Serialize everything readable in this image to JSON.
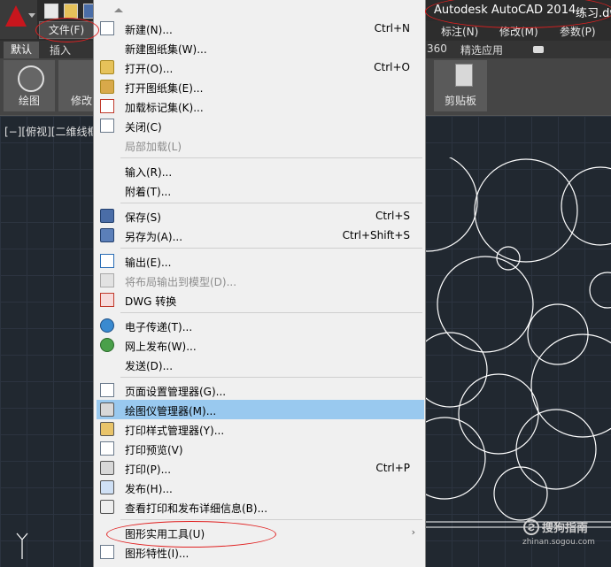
{
  "titlebar": {
    "title": "Autodesk AutoCAD 2014",
    "filename": "练习.dw"
  },
  "menubar": {
    "items": [
      "文件(F)",
      "标注(N)",
      "修改(M)",
      "参数(P)"
    ]
  },
  "ribbon": {
    "tabs": [
      "默认",
      "插入",
      "360",
      "精选应用"
    ],
    "buttons": [
      "绘图",
      "修改",
      "剪贴板"
    ]
  },
  "viewport": {
    "label": "[−][俯视][二维线框]",
    "axis_label": "Y"
  },
  "watermark": {
    "text": "搜狗指南",
    "url": "zhinan.sogou.com"
  },
  "file_menu": {
    "items": [
      {
        "label": "新建(N)...",
        "shortcut": "Ctrl+N",
        "icon": "new-document-icon"
      },
      {
        "label": "新建图纸集(W)...",
        "shortcut": "",
        "icon": ""
      },
      {
        "label": "打开(O)...",
        "shortcut": "Ctrl+O",
        "icon": "open-folder-icon"
      },
      {
        "label": "打开图纸集(E)...",
        "shortcut": "",
        "icon": "open-sheetset-icon"
      },
      {
        "label": "加载标记集(K)...",
        "shortcut": "",
        "icon": "markup-set-icon"
      },
      {
        "label": "关闭(C)",
        "shortcut": "",
        "icon": "close-document-icon"
      },
      {
        "label": "局部加载(L)",
        "shortcut": "",
        "icon": ""
      },
      {
        "label": "输入(R)...",
        "shortcut": "",
        "icon": ""
      },
      {
        "label": "附着(T)...",
        "shortcut": "",
        "icon": ""
      },
      {
        "label": "保存(S)",
        "shortcut": "Ctrl+S",
        "icon": "save-disk-icon"
      },
      {
        "label": "另存为(A)...",
        "shortcut": "Ctrl+Shift+S",
        "icon": "save-as-icon"
      },
      {
        "label": "输出(E)...",
        "shortcut": "",
        "icon": "export-icon"
      },
      {
        "label": "将布局输出到模型(D)...",
        "shortcut": "",
        "icon": "export-layout-icon"
      },
      {
        "label": "DWG 转换",
        "shortcut": "",
        "icon": "dwg-convert-icon"
      },
      {
        "label": "电子传递(T)...",
        "shortcut": "",
        "icon": "etransmit-icon"
      },
      {
        "label": "网上发布(W)...",
        "shortcut": "",
        "icon": "publish-web-icon"
      },
      {
        "label": "发送(D)...",
        "shortcut": "",
        "icon": ""
      },
      {
        "label": "页面设置管理器(G)...",
        "shortcut": "",
        "icon": "page-setup-icon"
      },
      {
        "label": "绘图仪管理器(M)...",
        "shortcut": "",
        "icon": "plotter-manager-icon"
      },
      {
        "label": "打印样式管理器(Y)...",
        "shortcut": "",
        "icon": "plot-style-icon"
      },
      {
        "label": "打印预览(V)",
        "shortcut": "",
        "icon": "print-preview-icon"
      },
      {
        "label": "打印(P)...",
        "shortcut": "Ctrl+P",
        "icon": "print-icon"
      },
      {
        "label": "发布(H)...",
        "shortcut": "",
        "icon": "publish-icon"
      },
      {
        "label": "查看打印和发布详细信息(B)...",
        "shortcut": "",
        "icon": "plot-details-icon"
      },
      {
        "label": "图形实用工具(U)",
        "shortcut": "",
        "icon": ""
      },
      {
        "label": "图形特性(I)...",
        "shortcut": "",
        "icon": "drawing-properties-icon"
      }
    ]
  }
}
